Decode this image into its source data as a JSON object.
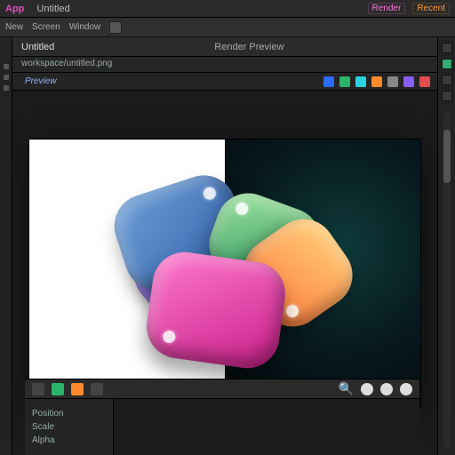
{
  "menubar": {
    "brand": "App",
    "items": [
      "Untitled"
    ],
    "right_tags": [
      "Render",
      "Recent"
    ]
  },
  "toolstrip": {
    "items": [
      "New",
      "Screen",
      "Window"
    ]
  },
  "tabs": {
    "active": "Untitled",
    "secondary": "Render Preview"
  },
  "breadcrumb": "workspace/untitled.png",
  "subtoolbar": {
    "hint": "Preview",
    "icons": [
      "blue",
      "green",
      "cyan",
      "orange",
      "gray",
      "purple",
      "red"
    ]
  },
  "statusbar": {
    "search_placeholder": "Search"
  },
  "panel": {
    "rows": [
      "Position",
      "Scale",
      "Alpha"
    ],
    "footer": ""
  },
  "colors": {
    "accent_pink": "#e24cc4",
    "accent_orange": "#ff9a3c"
  }
}
